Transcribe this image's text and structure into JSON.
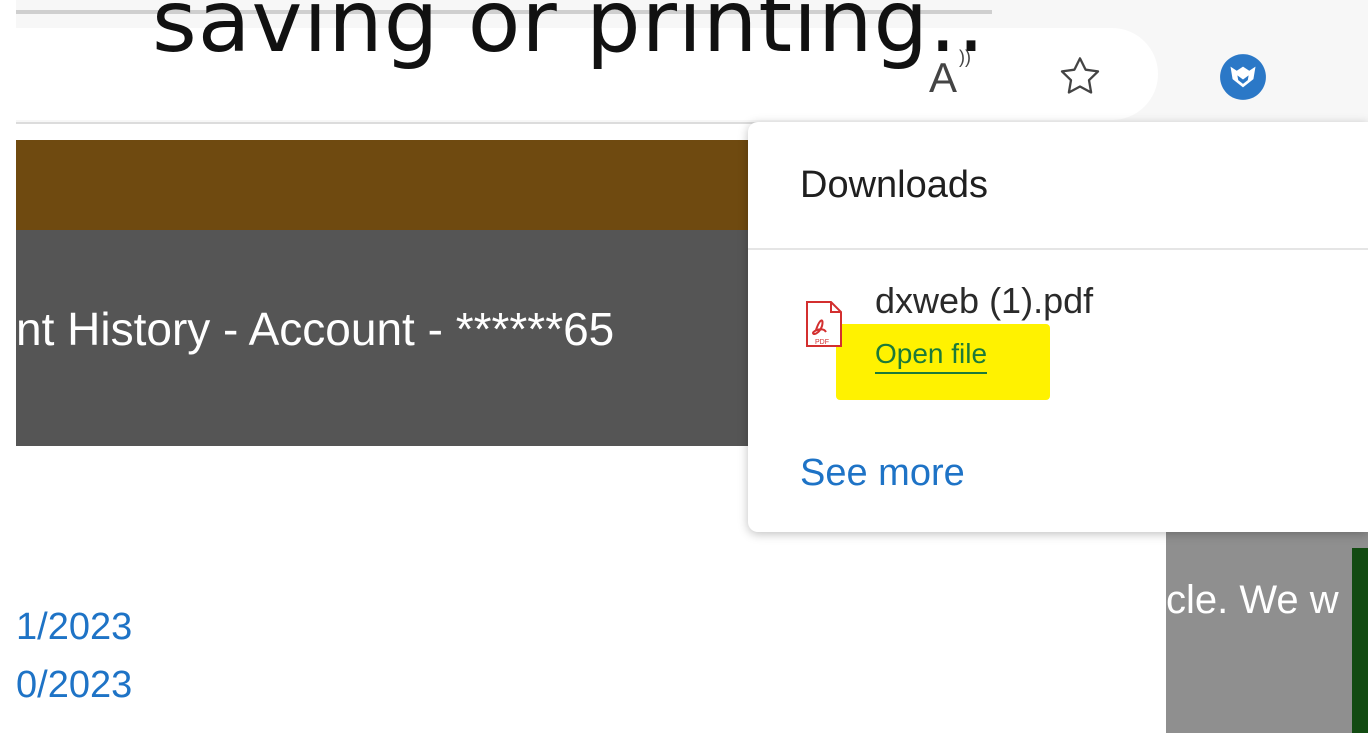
{
  "overlay": {
    "caption": "saving or printing.."
  },
  "toolbar": {
    "read_aloud_glyph": "A",
    "read_aloud_mark": "))",
    "icons": [
      "read-aloud-icon",
      "favorite-star-icon",
      "fox-extension-icon"
    ]
  },
  "page": {
    "heading": "nt History - Account - ******65",
    "dates": [
      "1/2023",
      "0/2023"
    ],
    "side_text": "cle. We w"
  },
  "downloads": {
    "title": "Downloads",
    "file_name": "dxweb (1).pdf",
    "open_label": "Open file",
    "see_more_label": "See more",
    "pdf_badge": "PDF"
  },
  "colors": {
    "brown_band": "#6f4a10",
    "gray_band": "#555555",
    "link_blue": "#1e73c6",
    "open_green": "#1c7a39",
    "highlight_yellow": "#fff200",
    "side_gray": "#8f8f8f",
    "green_bar": "#124b12"
  }
}
